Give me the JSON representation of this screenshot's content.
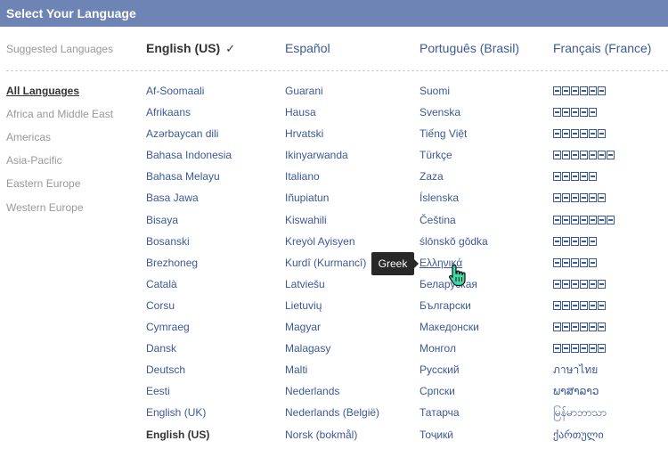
{
  "header": {
    "title": "Select Your Language"
  },
  "suggested": {
    "label": "Suggested Languages",
    "items": [
      "English (US)",
      "Español",
      "Português (Brasil)",
      "Français (France)"
    ],
    "check": "✓"
  },
  "sidebar": {
    "items": [
      "All Languages",
      "Africa and Middle East",
      "Americas",
      "Asia-Pacific",
      "Eastern Europe",
      "Western Europe"
    ]
  },
  "columns": [
    [
      "Af-Soomaali",
      "Afrikaans",
      "Azərbaycan dili",
      "Bahasa Indonesia",
      "Bahasa Melayu",
      "Basa Jawa",
      "Bisaya",
      "Bosanski",
      "Brezhoneg",
      "Català",
      "Corsu",
      "Cymraeg",
      "Dansk",
      "Deutsch",
      "Eesti",
      "English (UK)",
      "English (US)"
    ],
    [
      "Guarani",
      "Hausa",
      "Hrvatski",
      "Ikinyarwanda",
      "Italiano",
      "Iñupiatun",
      "Kiswahili",
      "Kreyòl Ayisyen",
      "Kurdî (Kurmancî)",
      "Latviešu",
      "Lietuvių",
      "Magyar",
      "Malagasy",
      "Malti",
      "Nederlands",
      "Nederlands (België)",
      "Norsk (bokmål)"
    ],
    [
      "Suomi",
      "Svenska",
      "Tiếng Việt",
      "Türkçe",
      "Zaza",
      "Íslenska",
      "Čeština",
      "ślōnskŏ gŏdka",
      "Ελληνικά",
      "Беларуская",
      "Български",
      "Македонски",
      "Монгол",
      "Русский",
      "Српски",
      "Татарча",
      "Тоҷикӣ"
    ],
    [
      "",
      "",
      "",
      "",
      "",
      "",
      "",
      "",
      "",
      "",
      "",
      "",
      "",
      "ภาษาไทย",
      "ພາສາລາວ",
      "မြန်မာဘာသာ",
      "ქართული"
    ]
  ],
  "fourth_col_tofu_counts": [
    6,
    5,
    6,
    7,
    5,
    6,
    7,
    5,
    5,
    6,
    6,
    6,
    6
  ],
  "tooltip": {
    "text": "Greek"
  }
}
